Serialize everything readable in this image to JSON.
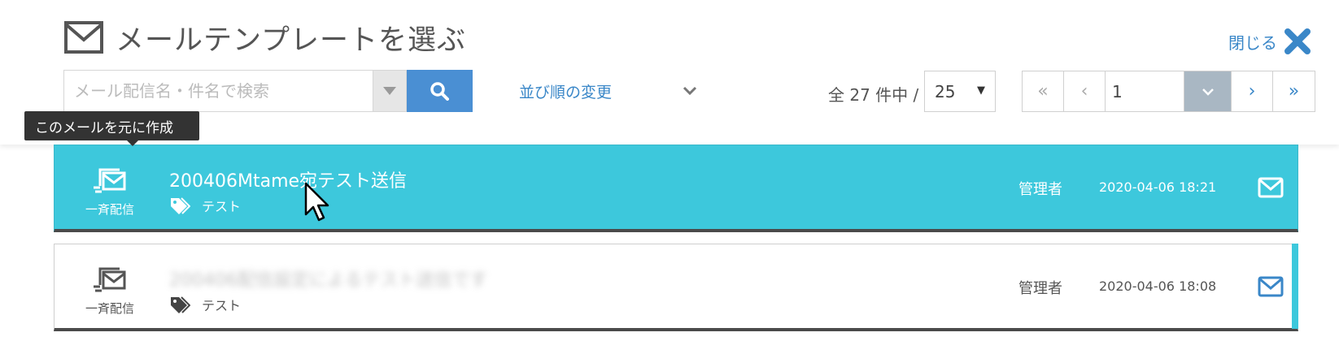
{
  "header": {
    "title": "メールテンプレートを選ぶ",
    "close_label": "閉じる"
  },
  "search": {
    "placeholder": "メール配信名・件名で検索",
    "value": ""
  },
  "sort": {
    "label": "並び順の変更"
  },
  "pagination": {
    "count_text": "全 27 件中 /",
    "per_page": "25",
    "page": "1",
    "first": "«",
    "prev": "‹",
    "next": "›",
    "last": "»"
  },
  "tooltip": "このメールを元に作成",
  "items": [
    {
      "type_label": "一斉配信",
      "title": "200406Mtame宛テスト送信",
      "tag": "テスト",
      "owner": "管理者",
      "date": "2020-04-06 18:21"
    },
    {
      "type_label": "一斉配信",
      "title": "200406配信設定によるテスト送信です",
      "tag": "テスト",
      "owner": "管理者",
      "date": "2020-04-06 18:08"
    }
  ],
  "colors": {
    "accent_blue": "#4a8fd3",
    "link_blue": "#3a87c8",
    "active_row": "#3dc8dc",
    "pager_dropdown": "#a9b7c3"
  }
}
